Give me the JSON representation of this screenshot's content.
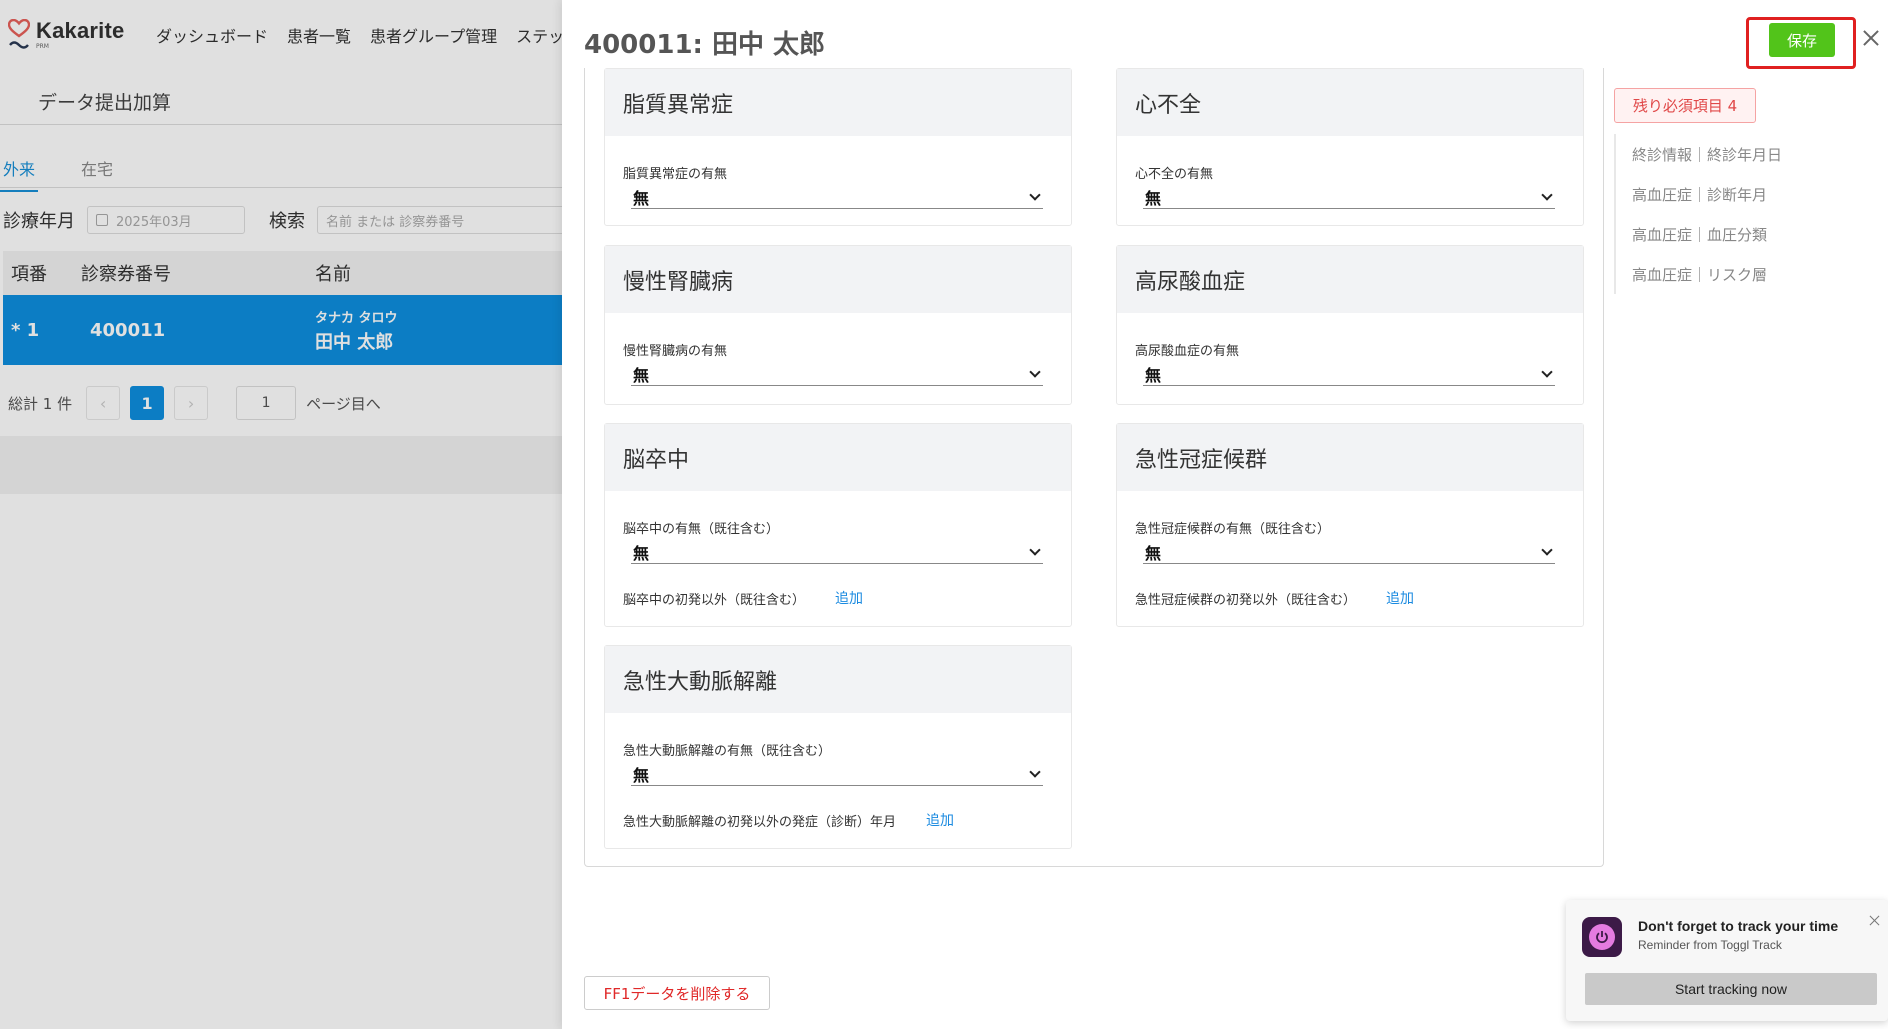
{
  "app": {
    "logo_name": "Kakarite",
    "logo_sub": "PRM",
    "nav": [
      "ダッシュボード",
      "患者一覧",
      "患者グループ管理",
      "ステップ配"
    ],
    "page_title": "データ提出加算",
    "tabs": [
      {
        "label": "外来",
        "active": true
      },
      {
        "label": "在宅",
        "active": false
      }
    ],
    "filters": {
      "month_label": "診療年月",
      "month_value": "2025年03月",
      "search_label": "検索",
      "search_placeholder": "名前 または 診察券番号"
    },
    "table": {
      "headers": [
        "項番",
        "診察券番号",
        "名前"
      ],
      "rows": [
        {
          "index": "* 1",
          "card_no": "400011",
          "kana": "タナカ タロウ",
          "name": "田中 太郎"
        }
      ]
    },
    "pagination": {
      "total": "総計 1 件",
      "prev": "‹",
      "current": "1",
      "next": "›",
      "goto_value": "1",
      "goto_label": "ページ目へ"
    }
  },
  "drawer": {
    "title": "400011: 田中 太郎",
    "save_label": "保存",
    "remaining_badge": "残り必須項目 4",
    "required_items": [
      "終診情報｜終診年月日",
      "高血圧症｜診断年月",
      "高血圧症｜血圧分類",
      "高血圧症｜リスク層"
    ],
    "cards": [
      {
        "title": "脂質異常症",
        "field_label": "脂質異常症の有無",
        "value": "無"
      },
      {
        "title": "心不全",
        "field_label": "心不全の有無",
        "value": "無"
      },
      {
        "title": "慢性腎臓病",
        "field_label": "慢性腎臓病の有無",
        "value": "無"
      },
      {
        "title": "高尿酸血症",
        "field_label": "高尿酸血症の有無",
        "value": "無"
      },
      {
        "title": "脳卒中",
        "field_label": "脳卒中の有無（既往含む）",
        "value": "無",
        "extra_label": "脳卒中の初発以外（既往含む）",
        "add_label": "追加"
      },
      {
        "title": "急性冠症候群",
        "field_label": "急性冠症候群の有無（既往含む）",
        "value": "無",
        "extra_label": "急性冠症候群の初発以外（既往含む）",
        "add_label": "追加"
      },
      {
        "title": "急性大動脈解離",
        "field_label": "急性大動脈解離の有無（既往含む）",
        "value": "無",
        "extra_label": "急性大動脈解離の初発以外の発症（診断）年月",
        "add_label": "追加"
      }
    ],
    "delete_label": "FF1データを削除する"
  },
  "toast": {
    "title": "Don't forget to track your time",
    "subtitle": "Reminder from Toggl Track",
    "button": "Start tracking now"
  },
  "colors": {
    "primary_blue": "#0e8fe0",
    "save_green": "#52c41a",
    "highlight_red": "#e02020",
    "toggl_purple": "#e47be0"
  }
}
